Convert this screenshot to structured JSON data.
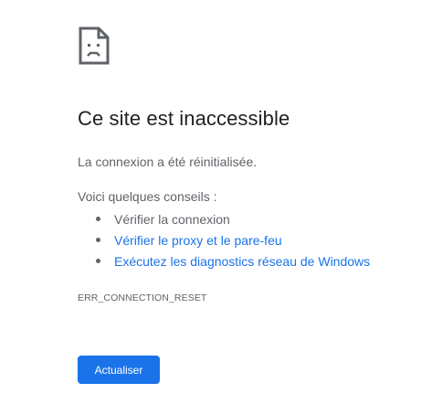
{
  "error_page": {
    "icon": "sad-page-icon",
    "title": "Ce site est inaccessible",
    "subtitle": "La connexion a été réinitialisée.",
    "tips_heading": "Voici quelques conseils :",
    "tips": [
      {
        "label": "Vérifier la connexion",
        "link": false
      },
      {
        "label": "Vérifier le proxy et le pare-feu",
        "link": true
      },
      {
        "label": "Exécutez les diagnostics réseau de Windows",
        "link": true
      }
    ],
    "error_code": "ERR_CONNECTION_RESET",
    "reload_label": "Actualiser"
  },
  "colors": {
    "accent": "#1a73e8",
    "title_text": "#202124",
    "secondary_text": "#5f6368",
    "button_text": "#ffffff",
    "background": "#ffffff"
  }
}
